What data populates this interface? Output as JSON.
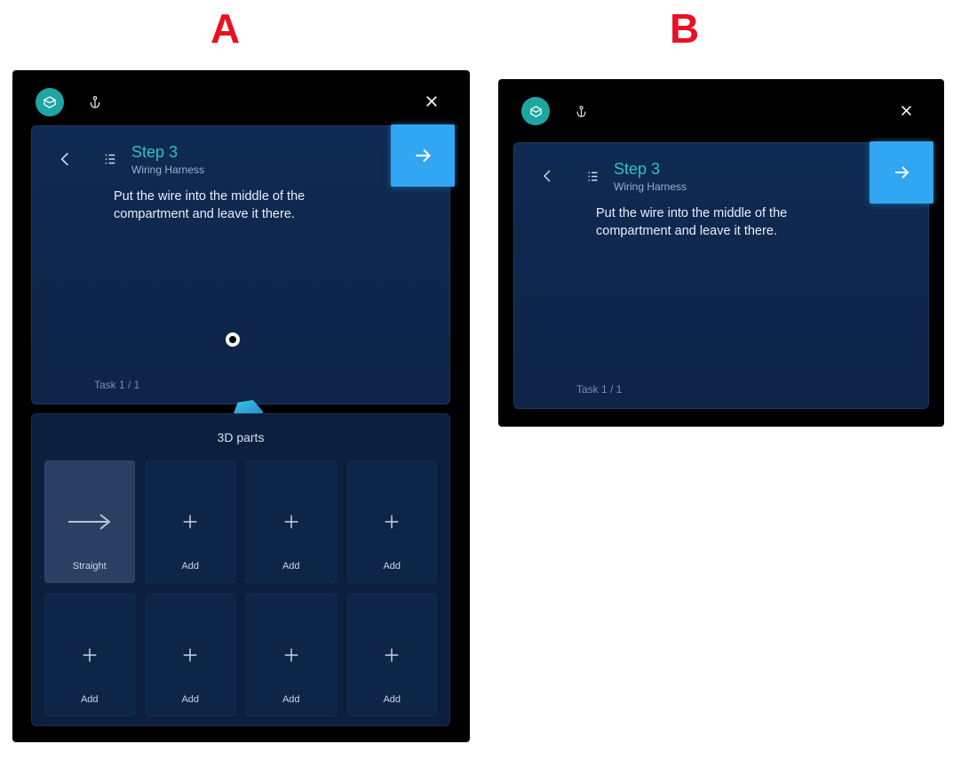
{
  "labels": {
    "a": "A",
    "b": "B"
  },
  "panel_a": {
    "step_title": "Step 3",
    "step_subtitle": "Wiring Harness",
    "instruction": "Put the wire into the middle of the compartment and leave it there.",
    "task_counter": "Task 1 / 1",
    "parts_title": "3D parts",
    "tiles": [
      {
        "label": "Straight",
        "type": "arrow",
        "selected": true
      },
      {
        "label": "Add",
        "type": "add",
        "selected": false
      },
      {
        "label": "Add",
        "type": "add",
        "selected": false
      },
      {
        "label": "Add",
        "type": "add",
        "selected": false
      },
      {
        "label": "Add",
        "type": "add",
        "selected": false
      },
      {
        "label": "Add",
        "type": "add",
        "selected": false
      },
      {
        "label": "Add",
        "type": "add",
        "selected": false
      },
      {
        "label": "Add",
        "type": "add",
        "selected": false
      }
    ]
  },
  "panel_b": {
    "step_title": "Step 3",
    "step_subtitle": "Wiring Harness",
    "instruction": "Put the wire into the middle of the compartment and leave it there.",
    "task_counter": "Task 1 / 1"
  }
}
